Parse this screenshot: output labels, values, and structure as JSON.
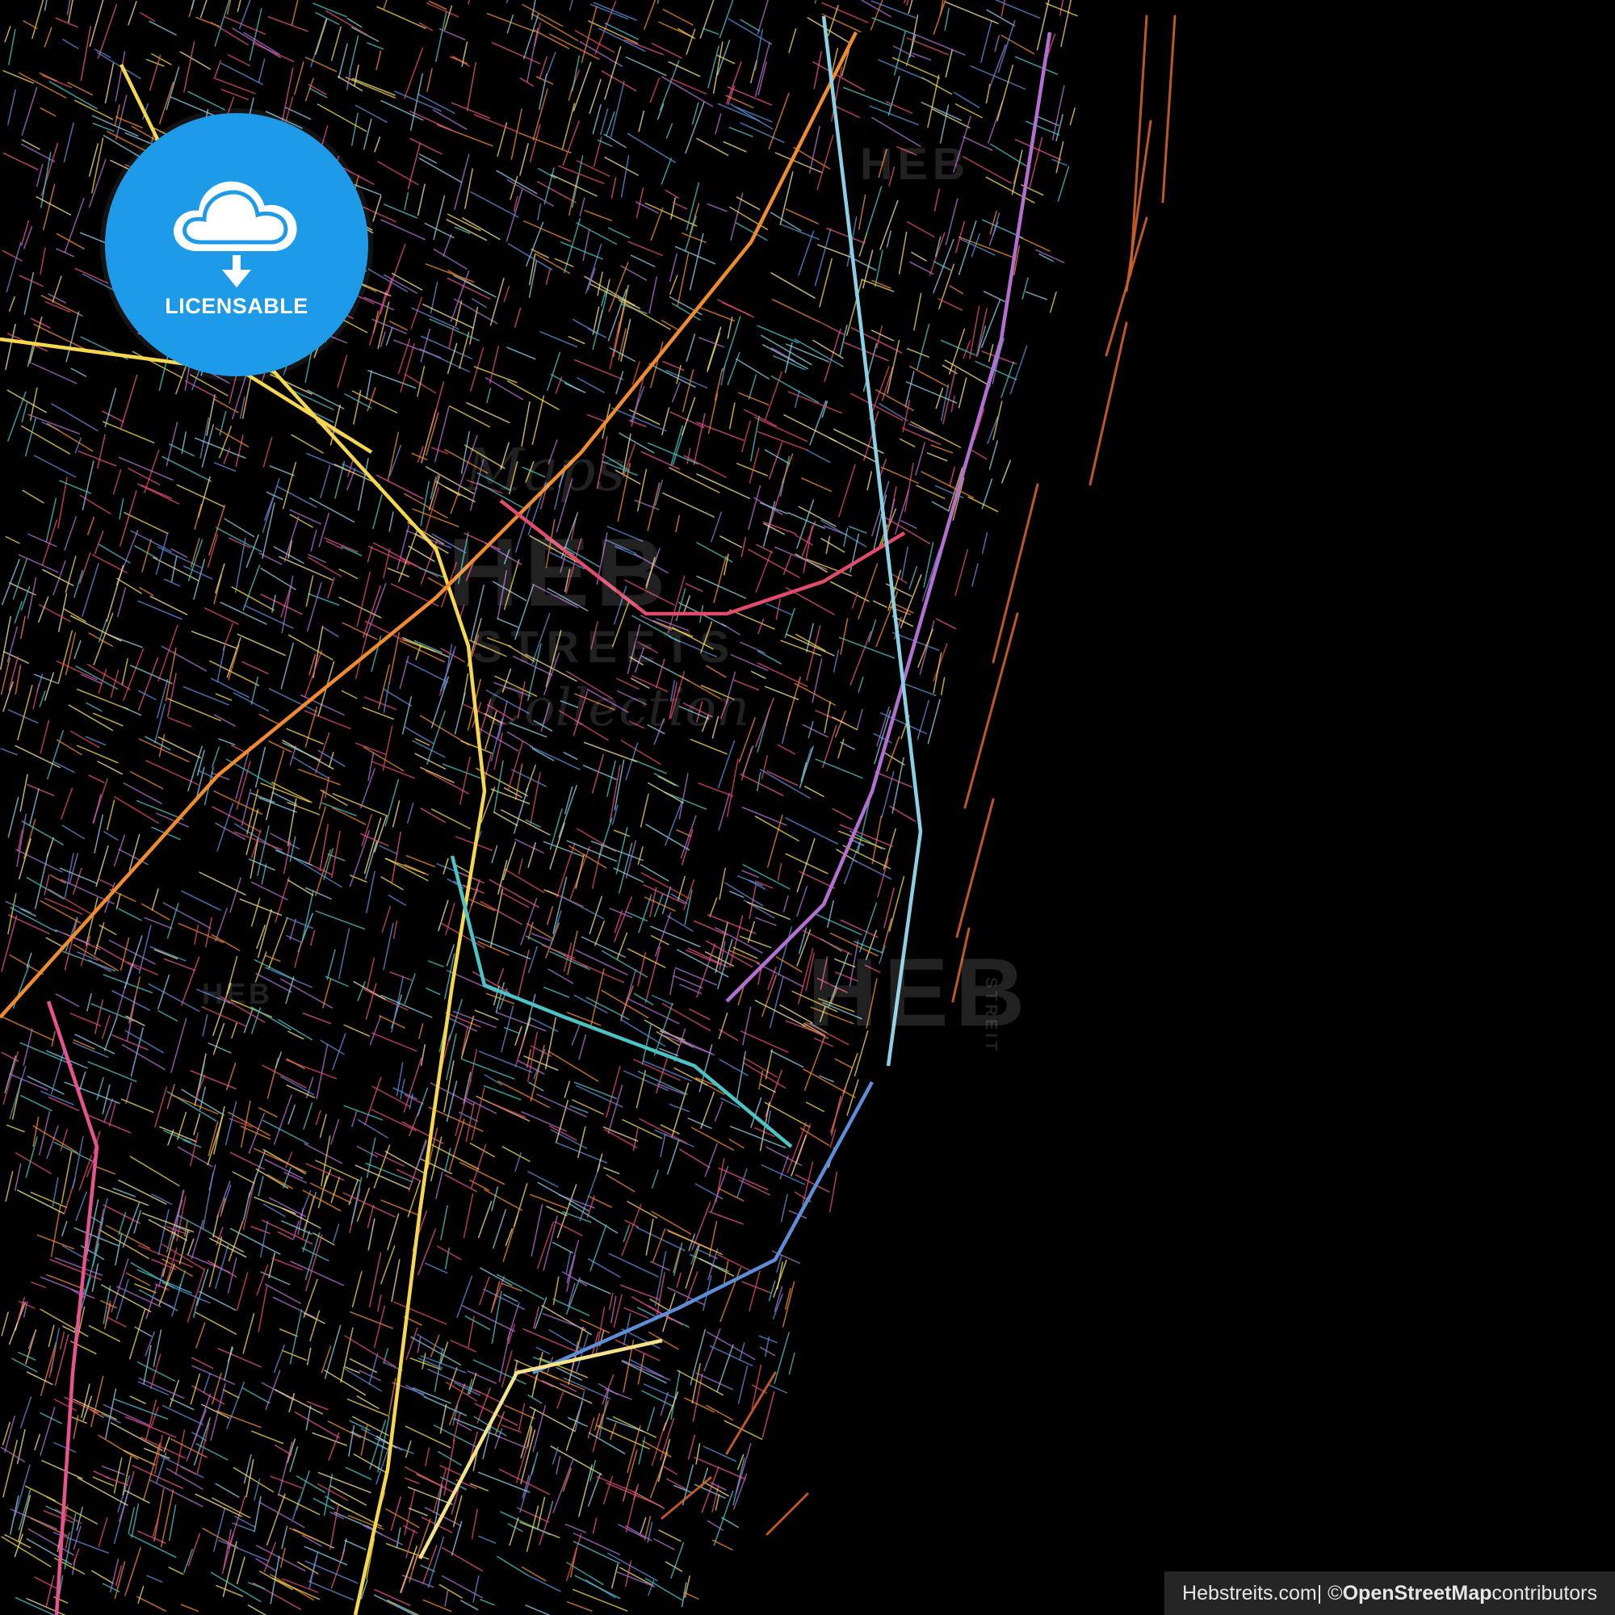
{
  "badge": {
    "label": "LICENSABLE",
    "icon": "cloud-download-icon",
    "color": "#1e9be8"
  },
  "watermarks": {
    "heb": "HEB",
    "streets": "STREETS",
    "streit": "STREIT",
    "script_1": "Maps",
    "script_2": "Collection"
  },
  "attribution": {
    "site": "Hebstreits.com",
    "separator": " | © ",
    "osm": "OpenStreetMap",
    "suffix": " contributors"
  },
  "map": {
    "background": "#000000",
    "road_colors": [
      "#f6d84c",
      "#f28b2c",
      "#e8528f",
      "#4bc4c6",
      "#5b8fd9",
      "#b36fd1",
      "#e24b6b",
      "#8ad0e6",
      "#f5e38a"
    ],
    "coast_color": "#d4622a"
  }
}
